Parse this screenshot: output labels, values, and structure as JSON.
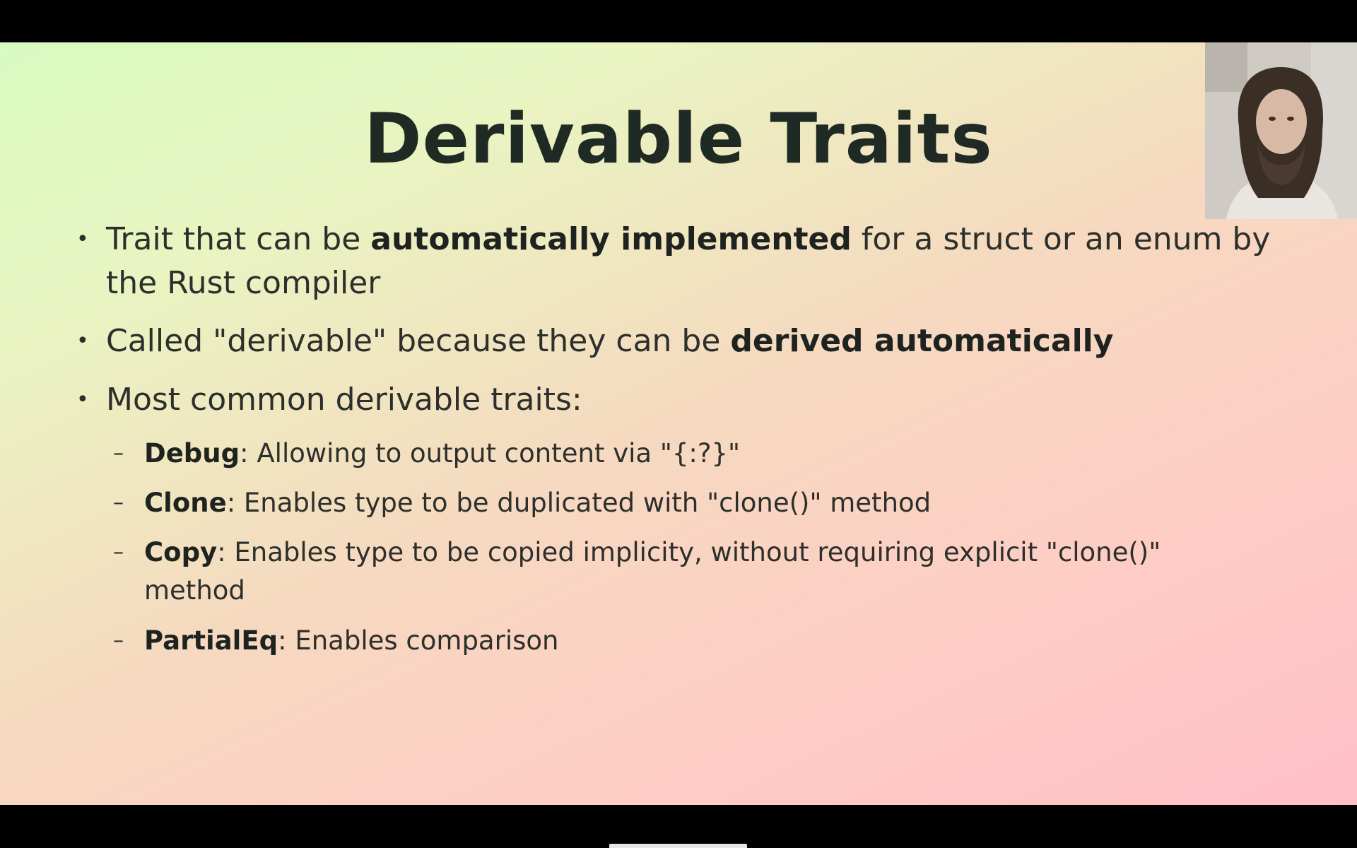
{
  "slide": {
    "title": "Derivable Traits",
    "bullets": [
      {
        "pre": "Trait that can be ",
        "bold": "automatically implemented",
        "post": " for a struct or an enum by the Rust compiler"
      },
      {
        "pre": "Called \"derivable\" because they can be ",
        "bold": "derived automatically",
        "post": ""
      },
      {
        "pre": "Most common derivable traits:",
        "bold": "",
        "post": ""
      }
    ],
    "sub_bullets": [
      {
        "name": "Debug",
        "desc": ": Allowing to output content via \"{:?}\""
      },
      {
        "name": "Clone",
        "desc": ": Enables type to be duplicated with \"clone()\" method"
      },
      {
        "name": "Copy",
        "desc": ": Enables type to be copied implicity, without requiring explicit \"clone()\" method"
      },
      {
        "name": "PartialEq",
        "desc": ": Enables comparison"
      }
    ]
  },
  "webcam": {
    "content": "presenter-video"
  },
  "colors": {
    "gradient_start": "#d7fbc0",
    "gradient_end": "#ffbfc6",
    "text": "#2c2f2b",
    "title": "#1f2a24",
    "letterbox": "#000000"
  }
}
